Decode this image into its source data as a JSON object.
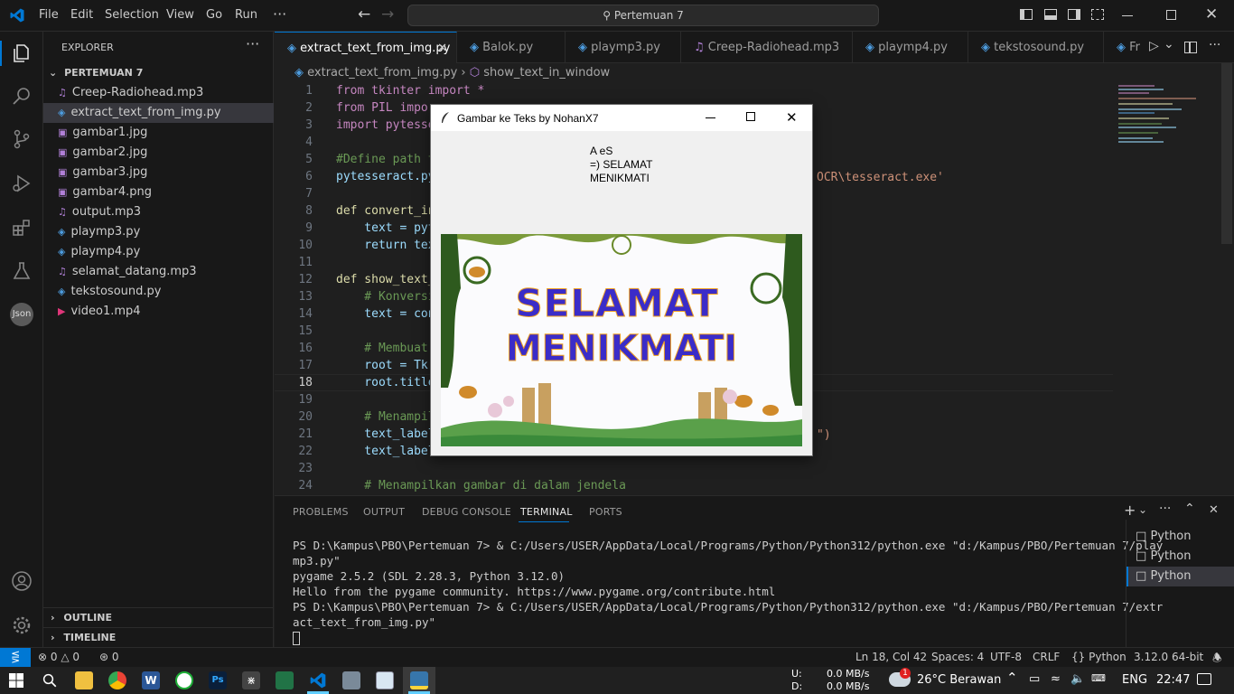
{
  "menubar": {
    "items": [
      "File",
      "Edit",
      "Selection",
      "View",
      "Go",
      "Run",
      "···"
    ],
    "search": "Pertemuan 7"
  },
  "sidebar": {
    "header": "EXPLORER",
    "folder": "PERTEMUAN 7",
    "files": [
      {
        "name": "Creep-Radiohead.mp3",
        "type": "audio"
      },
      {
        "name": "extract_text_from_img.py",
        "type": "python",
        "selected": true
      },
      {
        "name": "gambar1.jpg",
        "type": "image"
      },
      {
        "name": "gambar2.jpg",
        "type": "image"
      },
      {
        "name": "gambar3.jpg",
        "type": "image"
      },
      {
        "name": "gambar4.png",
        "type": "image"
      },
      {
        "name": "output.mp3",
        "type": "audio"
      },
      {
        "name": "playmp3.py",
        "type": "python"
      },
      {
        "name": "playmp4.py",
        "type": "python"
      },
      {
        "name": "selamat_datang.mp3",
        "type": "audio"
      },
      {
        "name": "tekstosound.py",
        "type": "python"
      },
      {
        "name": "video1.mp4",
        "type": "video"
      }
    ],
    "outline": "OUTLINE",
    "timeline": "TIMELINE"
  },
  "tabs": [
    "extract_text_from_img.py",
    "Balok.py",
    "playmp3.py",
    "Creep-Radiohead.mp3",
    "playmp4.py",
    "tekstosound.py",
    "Fr"
  ],
  "breadcrumb": {
    "file": "extract_text_from_img.py",
    "symbol": "show_text_in_window"
  },
  "code": {
    "lines": [
      {
        "n": "1",
        "t": "from tkinter import *"
      },
      {
        "n": "2",
        "t": "from PIL impor"
      },
      {
        "n": "3",
        "t": "import pytesse"
      },
      {
        "n": "4",
        "t": ""
      },
      {
        "n": "5",
        "t": "#Define path t"
      },
      {
        "n": "6",
        "t": "pytesseract.py"
      },
      {
        "n": "7",
        "t": ""
      },
      {
        "n": "8",
        "t": "def convert_in"
      },
      {
        "n": "9",
        "t": "    text = pyt"
      },
      {
        "n": "10",
        "t": "    return tex"
      },
      {
        "n": "11",
        "t": ""
      },
      {
        "n": "12",
        "t": "def show_text_"
      },
      {
        "n": "13",
        "t": "    # Konversi"
      },
      {
        "n": "14",
        "t": "    text = con"
      },
      {
        "n": "15",
        "t": ""
      },
      {
        "n": "16",
        "t": "    # Membuat"
      },
      {
        "n": "17",
        "t": "    root = Tk"
      },
      {
        "n": "18",
        "t": "    root.title"
      },
      {
        "n": "19",
        "t": ""
      },
      {
        "n": "20",
        "t": "    # Menampil"
      },
      {
        "n": "21",
        "t": "    text_label"
      },
      {
        "n": "22",
        "t": "    text_label"
      },
      {
        "n": "23",
        "t": ""
      },
      {
        "n": "24",
        "t": "    # Menampilkan gambar di dalam jendela"
      }
    ],
    "line6_tail": "OCR\\tesseract.exe'",
    "line21_tail": "\")"
  },
  "panel": {
    "tabs": [
      "PROBLEMS",
      "OUTPUT",
      "DEBUG CONSOLE",
      "TERMINAL",
      "PORTS"
    ],
    "active_tab": "TERMINAL",
    "terminal_lines": [
      "PS D:\\Kampus\\PBO\\Pertemuan 7> & C:/Users/USER/AppData/Local/Programs/Python/Python312/python.exe \"d:/Kampus/PBO/Pertemuan 7/play",
      "mp3.py\"",
      "pygame 2.5.2 (SDL 2.28.3, Python 3.12.0)",
      "Hello from the pygame community. https://www.pygame.org/contribute.html",
      "PS D:\\Kampus\\PBO\\Pertemuan 7> & C:/Users/USER/AppData/Local/Programs/Python/Python312/python.exe \"d:/Kampus/PBO/Pertemuan 7/extr",
      "act_text_from_img.py\""
    ],
    "terminals": [
      "Python",
      "Python",
      "Python"
    ]
  },
  "statusbar": {
    "errors": "0",
    "warnings": "0",
    "ports": "0",
    "position": "Ln 18, Col 42",
    "spaces": "Spaces: 4",
    "encoding": "UTF-8",
    "eol": "CRLF",
    "language": "Python",
    "interpreter": "3.12.0 64-bit"
  },
  "tk_window": {
    "title": "Gambar ke Teks by NohanX7",
    "ocr_lines": [
      "A eS",
      "=)  SELAMAT",
      "MENIKMATI"
    ],
    "image_text_1": "SELAMAT",
    "image_text_2": "MENIKMATI"
  },
  "taskbar": {
    "net_up_label": "U:",
    "net_down_label": "D:",
    "net_up": "0.0 MB/s",
    "net_down": "0.0 MB/s",
    "weather": "26°C  Berawan",
    "lang": "ENG",
    "time": "22:47",
    "notif_badge": "1"
  },
  "colors": {
    "accent": "#0078d4",
    "vscode_blue": "#0078d4",
    "keyword": "#c586c0",
    "builtin": "#569cd6",
    "function": "#dcdcaa",
    "variable": "#9cdcfe",
    "comment": "#6a9955",
    "string": "#ce9178",
    "banner_text": "#3b2cc8",
    "banner_outline": "#f0a020"
  }
}
